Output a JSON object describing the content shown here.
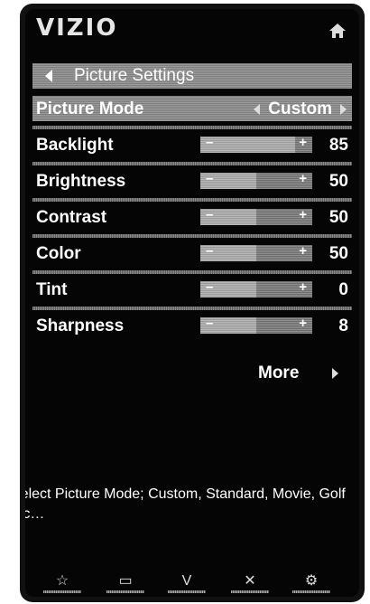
{
  "header": {
    "logo": "VIZIO",
    "home_icon": "home-icon"
  },
  "titlebar": {
    "title": "Picture Settings",
    "back_icon": "back-arrow-icon"
  },
  "picture_mode": {
    "label": "Picture Mode",
    "value": "Custom"
  },
  "sliders": [
    {
      "label": "Backlight",
      "value": "85",
      "level": 85
    },
    {
      "label": "Brightness",
      "value": "50",
      "level": 50
    },
    {
      "label": "Contrast",
      "value": "50",
      "level": 50
    },
    {
      "label": "Color",
      "value": "50",
      "level": 50
    },
    {
      "label": "Tint",
      "value": "0",
      "level": 50
    },
    {
      "label": "Sharpness",
      "value": "8",
      "level": 50
    }
  ],
  "slider_symbols": {
    "minus": "–",
    "plus": "+"
  },
  "more": {
    "label": "More"
  },
  "help_text": "Select Picture Mode; Custom, Standard, Movie, Golf etc…",
  "footer": {
    "buttons": [
      {
        "icon": "star-icon",
        "glyph": "☆"
      },
      {
        "icon": "input-icon",
        "glyph": "▭"
      },
      {
        "icon": "vizio-v-icon",
        "glyph": "V"
      },
      {
        "icon": "close-icon",
        "glyph": "✕"
      },
      {
        "icon": "gear-icon",
        "glyph": "⚙"
      }
    ]
  }
}
